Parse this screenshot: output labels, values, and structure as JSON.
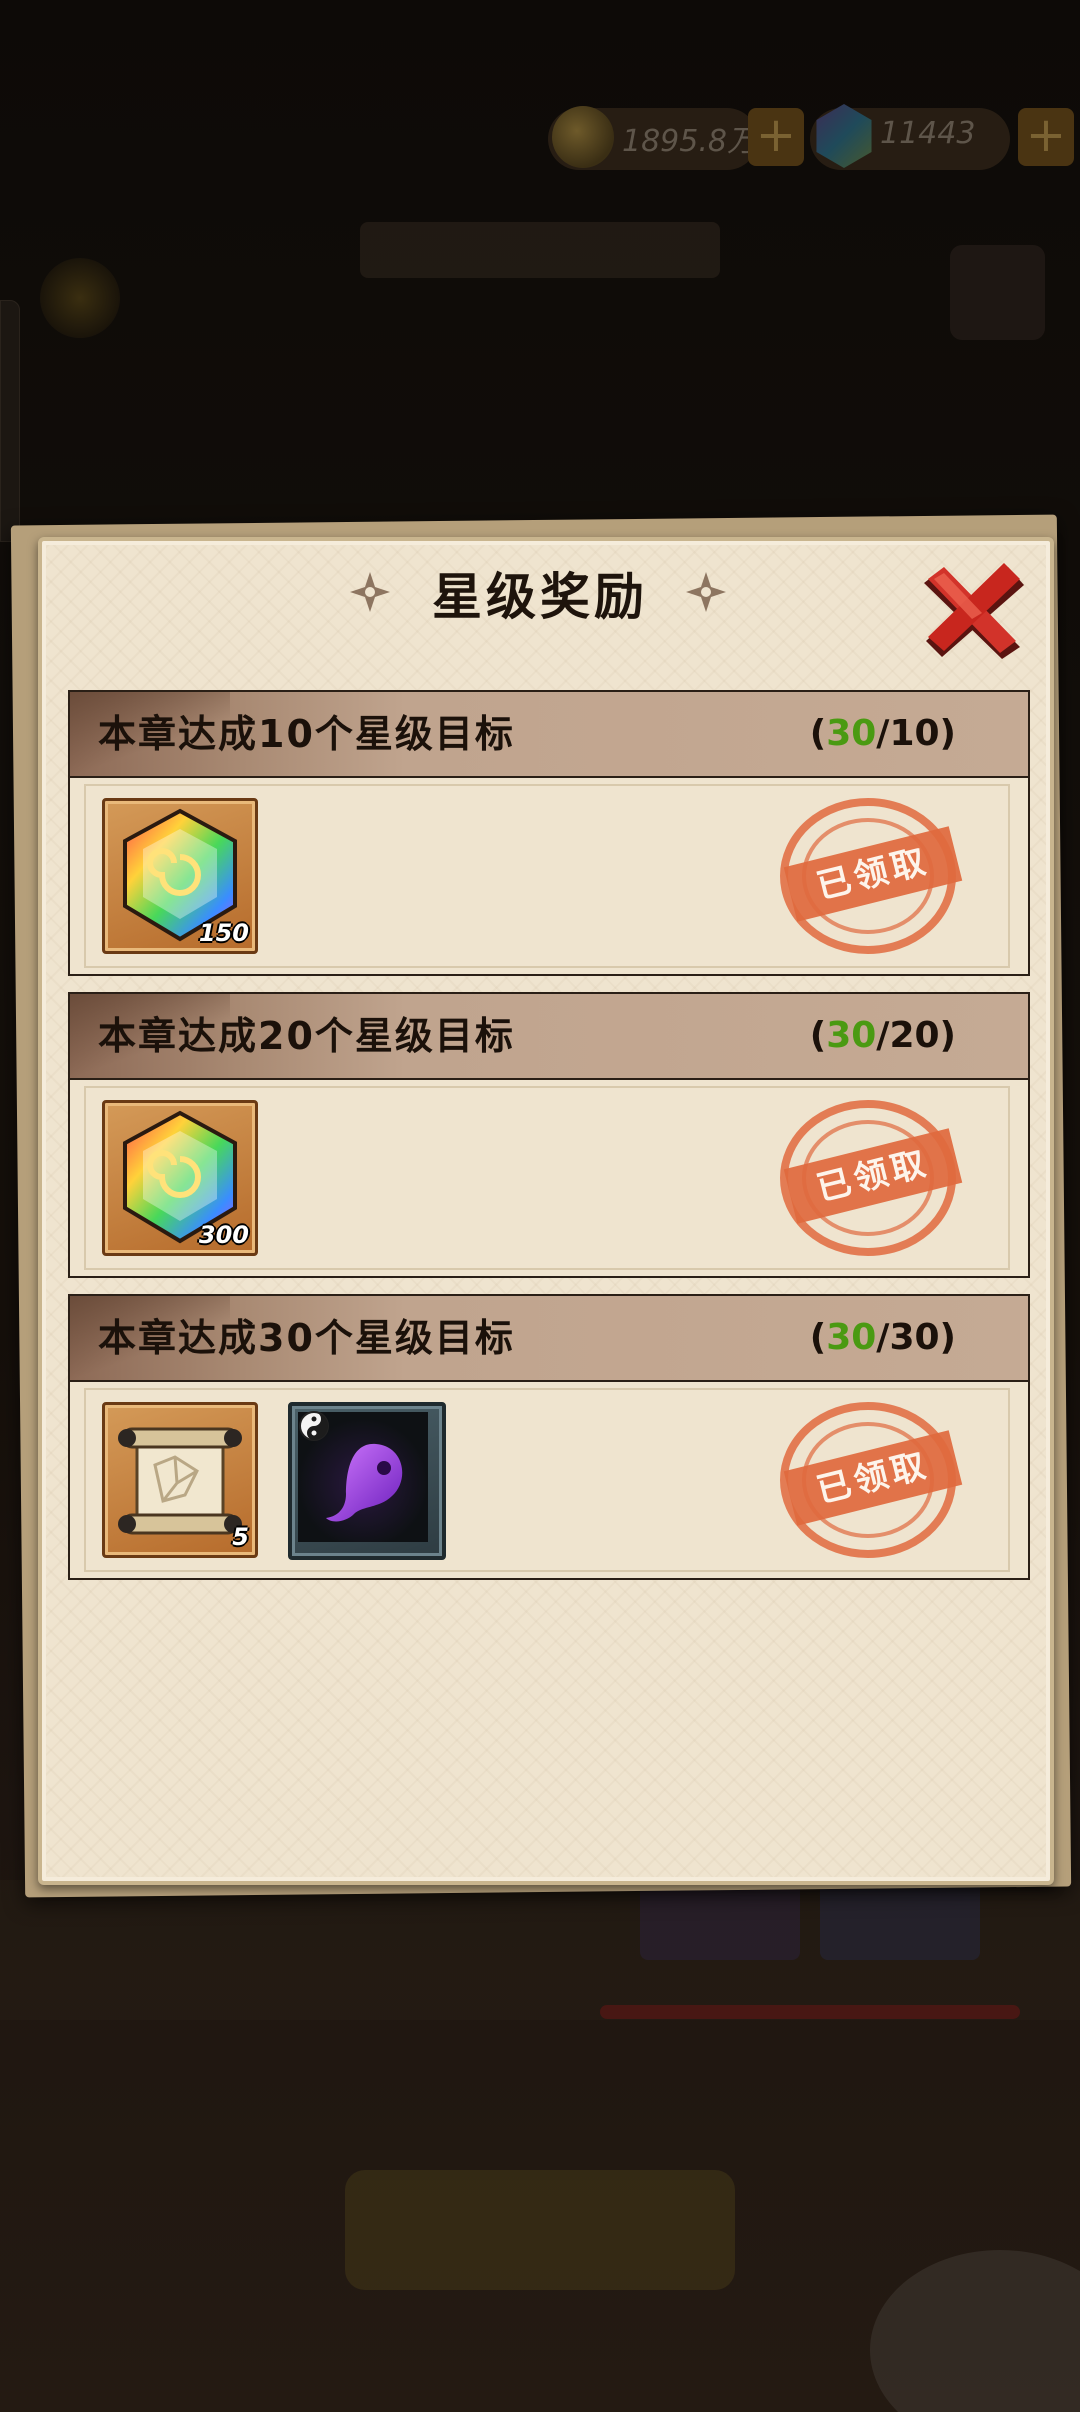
{
  "header": {
    "coins": "1895.8万",
    "gems": "11443"
  },
  "dialog": {
    "title": "星级奖励"
  },
  "rewards": [
    {
      "goal": "本章达成10个星级目标",
      "progress_current": "30",
      "progress_target": "/10",
      "items": [
        {
          "icon": "rainbow-gem-icon",
          "count": "150"
        }
      ],
      "status": "已领取"
    },
    {
      "goal": "本章达成20个星级目标",
      "progress_current": "30",
      "progress_target": "/20",
      "items": [
        {
          "icon": "rainbow-gem-icon",
          "count": "300"
        }
      ],
      "status": "已领取"
    },
    {
      "goal": "本章达成30个星级目标",
      "progress_current": "30",
      "progress_target": "/30",
      "items": [
        {
          "icon": "scroll-icon",
          "count": "5"
        },
        {
          "icon": "purple-spirit-icon",
          "count": ""
        }
      ],
      "status": "已领取"
    }
  ],
  "colors": {
    "progress_current": "#4a9a12",
    "stamp": "#e06a3e",
    "panel": "#efe4cf",
    "close_x": "#c8261e"
  }
}
